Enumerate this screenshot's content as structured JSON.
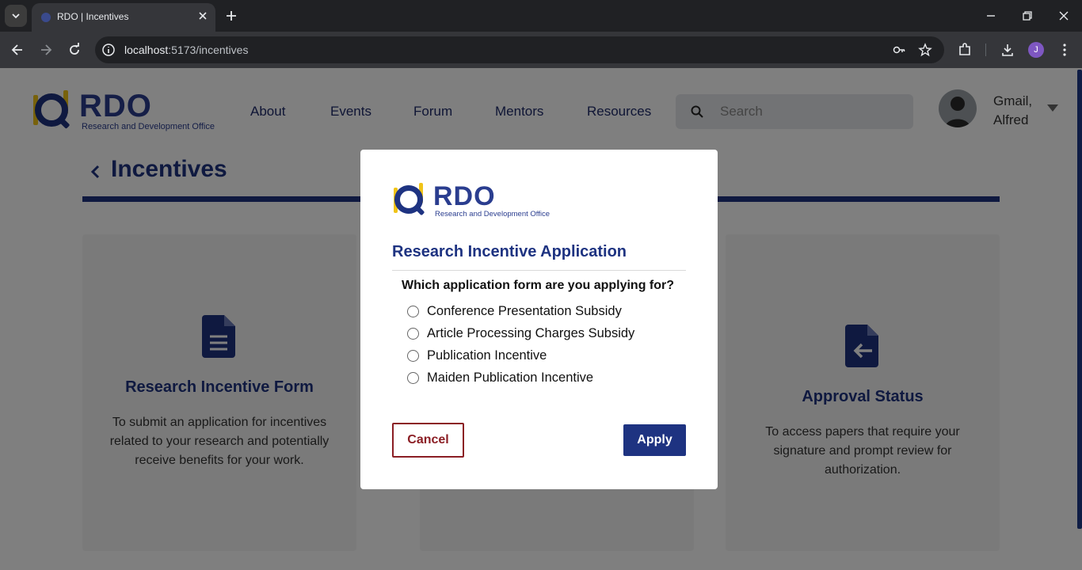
{
  "browser": {
    "tab_title": "RDO | Incentives",
    "url_host": "localhost",
    "url_path": ":5173/incentives",
    "profile_initial": "J"
  },
  "logo": {
    "letters": "RDO",
    "subtitle": "Research and Development Office"
  },
  "nav": {
    "items": [
      {
        "label": "About"
      },
      {
        "label": "Events"
      },
      {
        "label": "Forum"
      },
      {
        "label": "Mentors"
      },
      {
        "label": "Resources"
      }
    ]
  },
  "search": {
    "placeholder": "Search"
  },
  "user": {
    "line1": "Gmail,",
    "line2": "Alfred"
  },
  "page": {
    "title": "Incentives"
  },
  "cards": [
    {
      "title": "Research Incentive Form",
      "description": "To submit an application for incentives related to your research and potentially receive benefits for your work.",
      "icon": "document-icon"
    },
    {
      "title": "Approval Status",
      "description": "To access papers that require your signature and prompt review for authorization.",
      "icon": "file-return-icon"
    }
  ],
  "modal": {
    "title": "Research Incentive Application",
    "question": "Which application form are you applying for?",
    "options": [
      {
        "label": "Conference Presentation Subsidy"
      },
      {
        "label": "Article Processing Charges Subsidy"
      },
      {
        "label": "Publication Incentive"
      },
      {
        "label": "Maiden Publication Incentive"
      }
    ],
    "cancel_label": "Cancel",
    "apply_label": "Apply"
  },
  "colors": {
    "brand_navy": "#1e3381",
    "brand_yellow": "#f0c419",
    "cancel_red": "#8b1e24"
  }
}
